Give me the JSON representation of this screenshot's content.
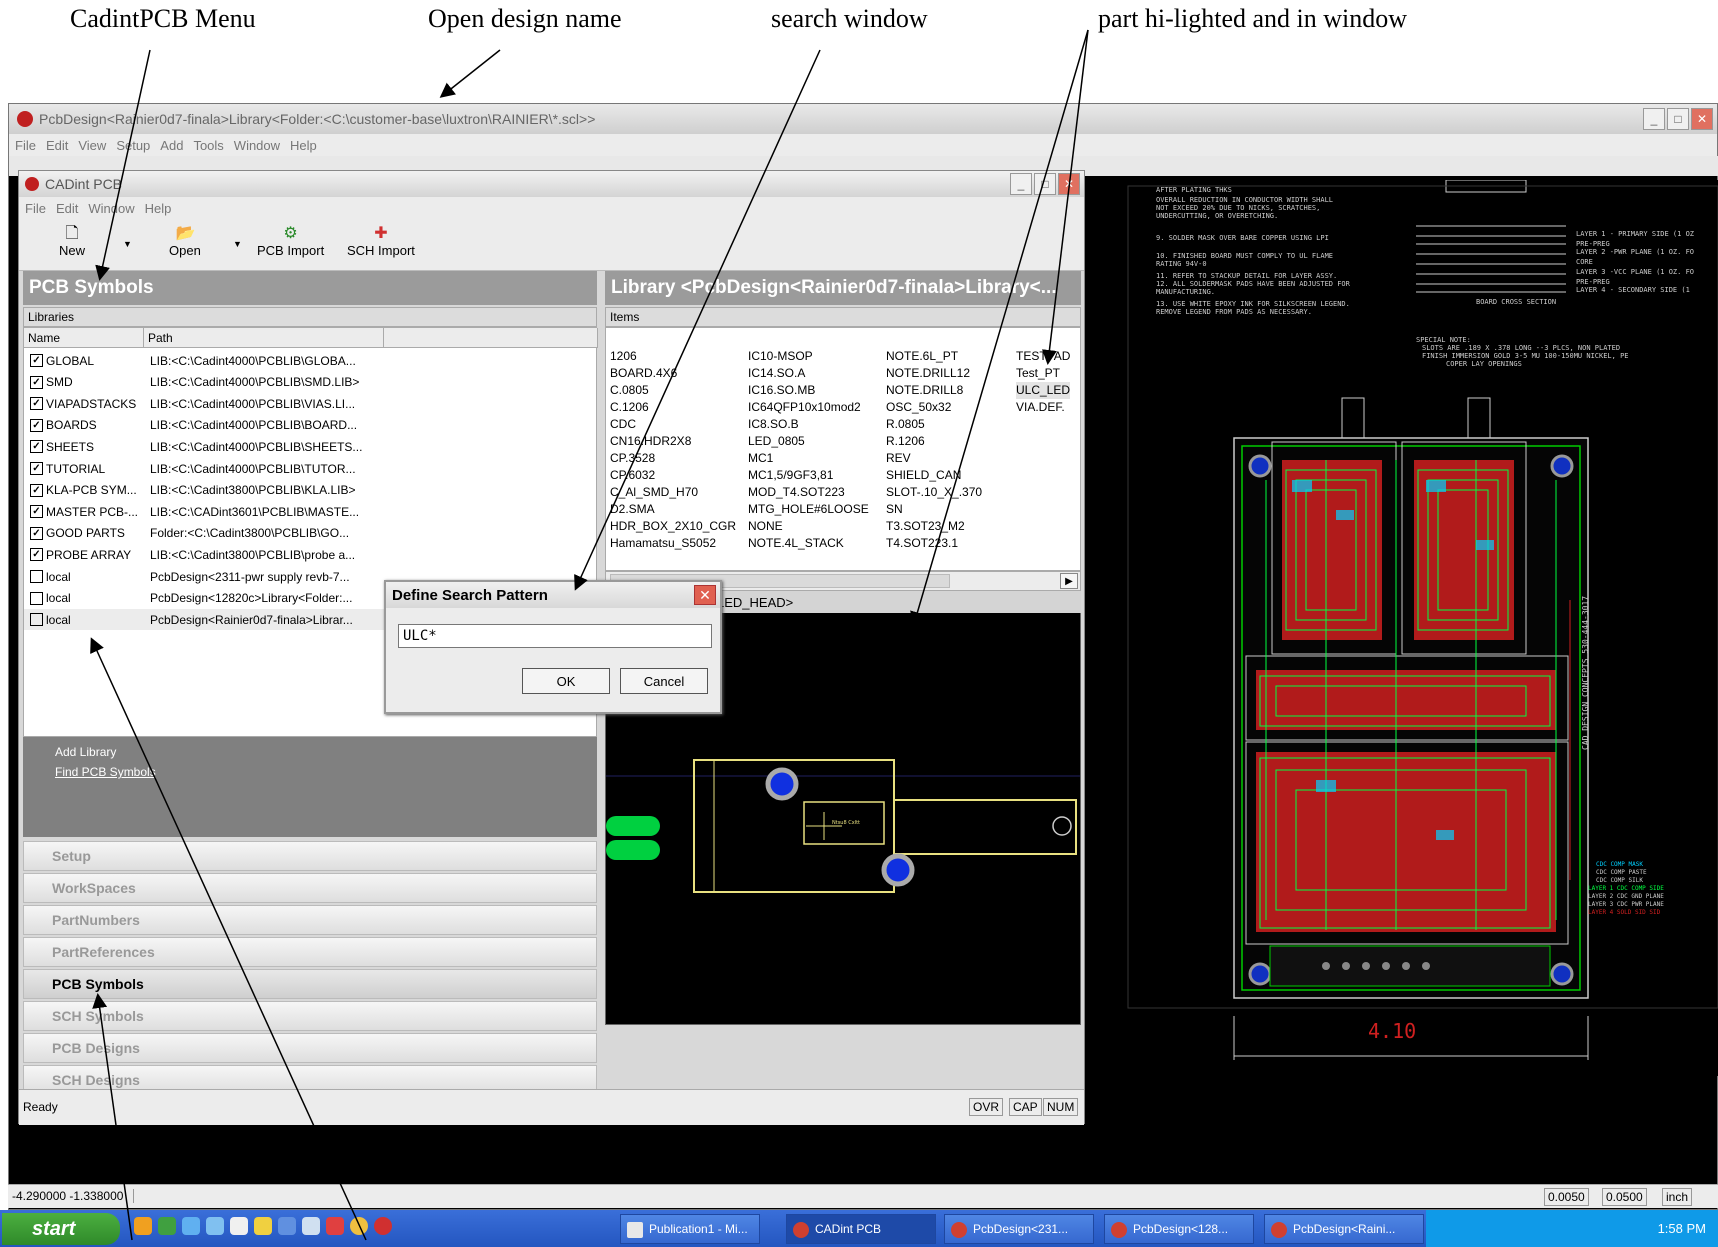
{
  "annotations": {
    "menu": "CadintPCB Menu",
    "design_name": "Open design name",
    "search": "search window",
    "part": "part hi-lighted and in window"
  },
  "outer_window": {
    "title": "PcbDesign<Rainier0d7-finala>Library<Folder:<C:\\customer-base\\luxtron\\RAINIER\\*.scl>>",
    "menu": [
      "File",
      "Edit",
      "View",
      "Setup",
      "Add",
      "Tools",
      "Window",
      "Help"
    ]
  },
  "inner_window": {
    "title": "CADint PCB",
    "menu": [
      "File",
      "Edit",
      "Window",
      "Help"
    ],
    "toolbar": [
      "New",
      "Open",
      "PCB Import",
      "SCH Import"
    ]
  },
  "left_pane": {
    "title": "PCB Symbols",
    "sub": "Libraries",
    "col_name": "Name",
    "col_path": "Path",
    "libraries": [
      {
        "checked": true,
        "name": "GLOBAL",
        "path": "LIB:<C:\\Cadint4000\\PCBLIB\\GLOBA..."
      },
      {
        "checked": true,
        "name": "SMD",
        "path": "LIB:<C:\\Cadint4000\\PCBLIB\\SMD.LIB>"
      },
      {
        "checked": true,
        "name": "VIAPADSTACKS",
        "path": "LIB:<C:\\Cadint4000\\PCBLIB\\VIAS.LI..."
      },
      {
        "checked": true,
        "name": "BOARDS",
        "path": "LIB:<C:\\Cadint4000\\PCBLIB\\BOARD..."
      },
      {
        "checked": true,
        "name": "SHEETS",
        "path": "LIB:<C:\\Cadint4000\\PCBLIB\\SHEETS..."
      },
      {
        "checked": true,
        "name": "TUTORIAL",
        "path": "LIB:<C:\\Cadint4000\\PCBLIB\\TUTOR..."
      },
      {
        "checked": true,
        "name": "KLA-PCB SYM...",
        "path": "LIB:<C:\\Cadint3800\\PCBLIB\\KLA.LIB>"
      },
      {
        "checked": true,
        "name": "MASTER PCB-...",
        "path": "LIB:<C:\\CADint3601\\PCBLIB\\MASTE..."
      },
      {
        "checked": true,
        "name": "GOOD PARTS",
        "path": "Folder:<C:\\Cadint3800\\PCBLIB\\GO..."
      },
      {
        "checked": true,
        "name": "PROBE ARRAY",
        "path": "LIB:<C:\\Cadint3800\\PCBLIB\\probe a..."
      },
      {
        "checked": false,
        "name": "local",
        "path": "PcbDesign<2311-pwr supply revb-7..."
      },
      {
        "checked": false,
        "name": "local",
        "path": "PcbDesign<12820c>Library<Folder:..."
      },
      {
        "checked": false,
        "name": "local",
        "path": "PcbDesign<Rainier0d7-finala>Librar..."
      }
    ],
    "actions": [
      "Add Library",
      "Find PCB Symbols"
    ],
    "nav": [
      "Setup",
      "WorkSpaces",
      "PartNumbers",
      "PartReferences",
      "PCB Symbols",
      "SCH Symbols",
      "PCB Designs",
      "SCH Designs"
    ]
  },
  "right_pane": {
    "title": "Library <PcbDesign<Rainier0d7-finala>Library<...",
    "sub": "Items",
    "col1": [
      "1206",
      "BOARD.4X6",
      "C.0805",
      "C.1206",
      "CDC",
      "CN16.HDR2X8",
      "CP.3528",
      "CP.6032",
      "C_Al_SMD_H70",
      "D2.SMA",
      "HDR_BOX_2X10_CGR",
      "Hamamatsu_S5052"
    ],
    "col2": [
      "IC10-MSOP",
      "IC14.SO.A",
      "IC16.SO.MB",
      "IC64QFP10x10mod2",
      "IC8.SO.B",
      "LED_0805",
      "MC1",
      "MC1,5/9GF3,81",
      "MOD_T4.SOT223",
      "MTG_HOLE#6LOOSE",
      "NONE",
      "NOTE.4L_STACK"
    ],
    "col3": [
      "NOTE.6L_PT",
      "NOTE.DRILL12",
      "NOTE.DRILL8",
      "OSC_50x32",
      "R.0805",
      "R.1206",
      "REV",
      "SHIELD_CAN",
      "SLOT-.10_X_.370",
      "SN",
      "T3.SOT23_M2",
      "T4.SOT223.1"
    ],
    "col4": [
      "TESTPAD",
      "Test_PT",
      "ULC_LED",
      "VIA.DEF."
    ],
    "preview_title": "LED_HEAD>",
    "preview_label": "Ntsu8 Cxltt"
  },
  "status": {
    "text": "Ready",
    "ovr": "OVR",
    "cap": "CAP",
    "num": "NUM"
  },
  "dialog": {
    "title": "Define Search Pattern",
    "value": "ULC*",
    "ok": "OK",
    "cancel": "Cancel"
  },
  "pcb": {
    "dimension": "4.10",
    "notes": [
      "LAYER 1 - PRIMARY SIDE (1 OZ",
      "PRE-PREG",
      "LAYER 2 -PWR PLANE (1 OZ. FO",
      "CORE",
      "LAYER 3 -VCC PLANE (1 OZ. FO",
      "PRE-PREG",
      "LAYER 4 - SECONDARY SIDE (1",
      "BOARD CROSS SECTION",
      "SPECIAL NOTE:",
      "SLOTS ARE .189 X .378 LONG --3 PLCS, NON PLATED",
      "FINISH IMMERSION GOLD 3-5 MU 100-150MU NICKEL, PE",
      "COPER LAY OPENINGS"
    ],
    "side_text": "CAD DESIGN CONCEPTS 530-444-3017"
  },
  "bottom": {
    "coords": "-4.290000  -1.338000",
    "v1": "0.0050",
    "v2": "0.0500",
    "unit": "inch"
  },
  "taskbar": {
    "start": "start",
    "buttons": [
      "Publication1 - Mi...",
      "CADint PCB",
      "PcbDesign<231...",
      "PcbDesign<128...",
      "PcbDesign<Raini..."
    ],
    "time": "1:58 PM"
  }
}
